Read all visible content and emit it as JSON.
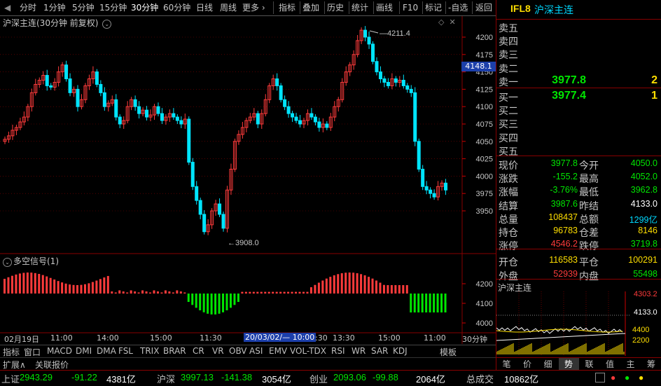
{
  "toolbar": {
    "periods": [
      "分时",
      "1分钟",
      "5分钟",
      "15分钟",
      "30分钟",
      "60分钟",
      "日线",
      "周线",
      "更多"
    ],
    "more_arrow": "›",
    "active_period": "30分钟",
    "tools": [
      "指标",
      "叠加",
      "历史",
      "统计",
      "画线",
      "F10",
      "标记",
      "-自选",
      "返回"
    ]
  },
  "chart": {
    "title": "沪深主连(30分钟 前复权)",
    "price_ticks": [
      "4200",
      "4175",
      "4150",
      "4125",
      "4100",
      "4075",
      "4050",
      "4025",
      "4000",
      "3975",
      "3950"
    ],
    "current_price_tag": "4148.1",
    "high_label": "4211.4",
    "low_label": "3908.0",
    "indicator_title": "多空信号(1)",
    "indicator_ticks": [
      "4200",
      "4100",
      "4000"
    ],
    "period_label": "30分钟",
    "time_labels": [
      "02月19日",
      "11:00",
      "14:00",
      "15:00",
      "11:30",
      "14:30",
      "13:30",
      "15:00",
      "11:00"
    ],
    "crosshair_time": "20/03/02/— 10:00",
    "colors": {
      "up": "#ff3b3b",
      "down": "#00e5ff",
      "bar_green": "#00e600"
    }
  },
  "indicator_tabs": [
    "指标",
    "窗口",
    "MACD",
    "DMI",
    "DMA",
    "FSL",
    "TRIX",
    "BRAR",
    "CR",
    "VR",
    "OBV",
    "ASI",
    "EMV",
    "VOL-TDX",
    "RSI",
    "WR",
    "SAR",
    "KDJ",
    "模板"
  ],
  "sub_tabs": [
    "扩展∧",
    "关联报价"
  ],
  "quote": {
    "code": "IFL8",
    "name": "沪深主连",
    "asks": [
      {
        "label": "卖五",
        "price": "",
        "vol": ""
      },
      {
        "label": "卖四",
        "price": "",
        "vol": ""
      },
      {
        "label": "卖三",
        "price": "",
        "vol": ""
      },
      {
        "label": "卖二",
        "price": "",
        "vol": ""
      },
      {
        "label": "卖一",
        "price": "3977.8",
        "vol": "2"
      }
    ],
    "bids": [
      {
        "label": "买一",
        "price": "3977.4",
        "vol": "1"
      },
      {
        "label": "买二",
        "price": "",
        "vol": ""
      },
      {
        "label": "买三",
        "price": "",
        "vol": ""
      },
      {
        "label": "买四",
        "price": "",
        "vol": ""
      },
      {
        "label": "买五",
        "price": "",
        "vol": ""
      }
    ],
    "stats": [
      {
        "l1": "现价",
        "v1": "3977.8",
        "c1": "green",
        "l2": "今开",
        "v2": "4050.0",
        "c2": "green"
      },
      {
        "l1": "涨跌",
        "v1": "-155.2",
        "c1": "green",
        "l2": "最高",
        "v2": "4052.0",
        "c2": "green"
      },
      {
        "l1": "涨幅",
        "v1": "-3.76%",
        "c1": "green",
        "l2": "最低",
        "v2": "3962.8",
        "c2": "green"
      },
      {
        "l1": "结算",
        "v1": "3987.6",
        "c1": "green",
        "l2": "昨结",
        "v2": "4133.0",
        "c2": "white"
      },
      {
        "l1": "总量",
        "v1": "108437",
        "c1": "yellow",
        "l2": "总额",
        "v2": "1299亿",
        "c2": "cyan"
      },
      {
        "l1": "持仓",
        "v1": "96783",
        "c1": "yellow",
        "l2": "仓差",
        "v2": "8146",
        "c2": "yellow"
      },
      {
        "l1": "涨停",
        "v1": "4546.2",
        "c1": "red",
        "l2": "跌停",
        "v2": "3719.8",
        "c2": "green"
      },
      {
        "l1": "开仓",
        "v1": "116583",
        "c1": "yellow",
        "l2": "平仓",
        "v2": "100291",
        "c2": "yellow"
      },
      {
        "l1": "外盘",
        "v1": "52939",
        "c1": "red",
        "l2": "内盘",
        "v2": "55498",
        "c2": "green"
      }
    ],
    "mini_title": "沪深主连",
    "mini_ticks": [
      "4303.2",
      "4133.0",
      "4400",
      "2200"
    ],
    "bottom_tabs": [
      "笔",
      "价",
      "细",
      "势",
      "联",
      "值",
      "主",
      "筹"
    ],
    "active_tab": "势"
  },
  "statusbar": [
    {
      "name": "上证",
      "value": "2943.29",
      "change": "-91.22",
      "amount": "4381亿"
    },
    {
      "name": "沪深",
      "value": "3997.13",
      "change": "-141.38",
      "amount": "3054亿"
    },
    {
      "name": "创业",
      "value": "2093.06",
      "change": "-99.88",
      "amount": "2064亿"
    }
  ],
  "total_label": "总成交",
  "total_value": "10862亿"
}
